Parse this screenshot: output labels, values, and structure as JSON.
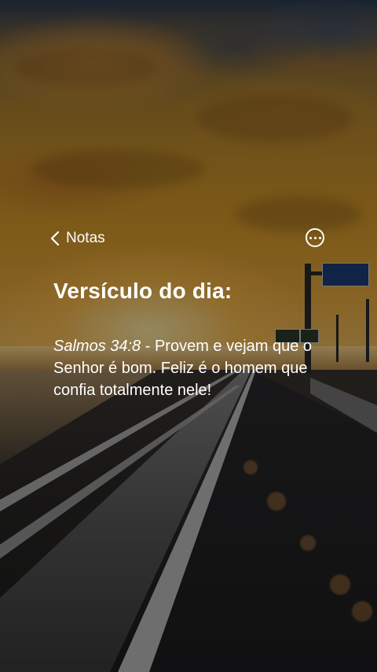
{
  "header": {
    "back_label": "Notas",
    "back_icon": "chevron-left-icon",
    "more_icon": "more-horizontal-circle-icon"
  },
  "content": {
    "title": "Versículo do dia:",
    "verse_reference": "Salmos 34:8",
    "verse_separator": " - ",
    "verse_text": "Provem e vejam que o Senhor é bom. Feliz é o homem que confia totalmente nele!"
  },
  "colors": {
    "text": "#ffffff",
    "overlay": "rgba(0,0,0,0.42)",
    "sky_gold": "#d79a2a"
  }
}
